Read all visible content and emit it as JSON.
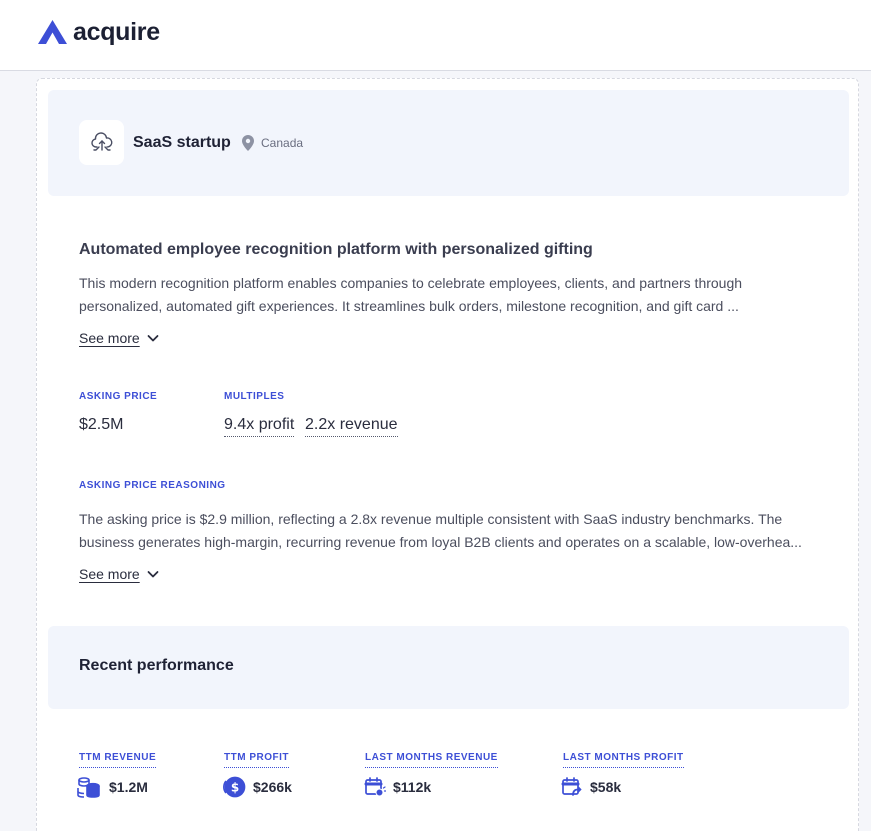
{
  "header": {
    "brand": "acquire",
    "logo_icon": "acquire-logo-icon",
    "brand_color": "#3d4fd6"
  },
  "listing": {
    "icon": "cloud-upload-icon",
    "name": "SaaS startup",
    "location_icon": "location-pin-icon",
    "location": "Canada",
    "headline": "Automated employee recognition platform with personalized gifting",
    "description": "This modern recognition platform enables companies to celebrate employees, clients, and partners through personalized, automated gift experiences. It streamlines bulk orders, milestone recognition, and gift card ...",
    "see_more": "See more",
    "asking_price_label": "ASKING PRICE",
    "asking_price": "$2.5M",
    "multiples_label": "MULTIPLES",
    "multiples": [
      "9.4x profit",
      "2.2x revenue"
    ],
    "reasoning_label": "ASKING PRICE REASONING",
    "reasoning": "The asking price is $2.9 million, reflecting a 2.8x revenue multiple consistent with SaaS industry benchmarks. The business generates high-margin, recurring revenue from loyal B2B clients and operates on a scalable, low-overhea...",
    "reasoning_see_more": "See more"
  },
  "performance": {
    "title": "Recent performance",
    "metrics": [
      {
        "label": "TTM REVENUE",
        "value": "$1.2M",
        "icon": "coins-stack-icon"
      },
      {
        "label": "TTM PROFIT",
        "value": "$266k",
        "icon": "dollar-coin-icon"
      },
      {
        "label": "LAST MONTHS REVENUE",
        "value": "$112k",
        "icon": "calendar-revenue-icon"
      },
      {
        "label": "LAST MONTHS PROFIT",
        "value": "$58k",
        "icon": "calendar-profit-icon"
      }
    ]
  }
}
